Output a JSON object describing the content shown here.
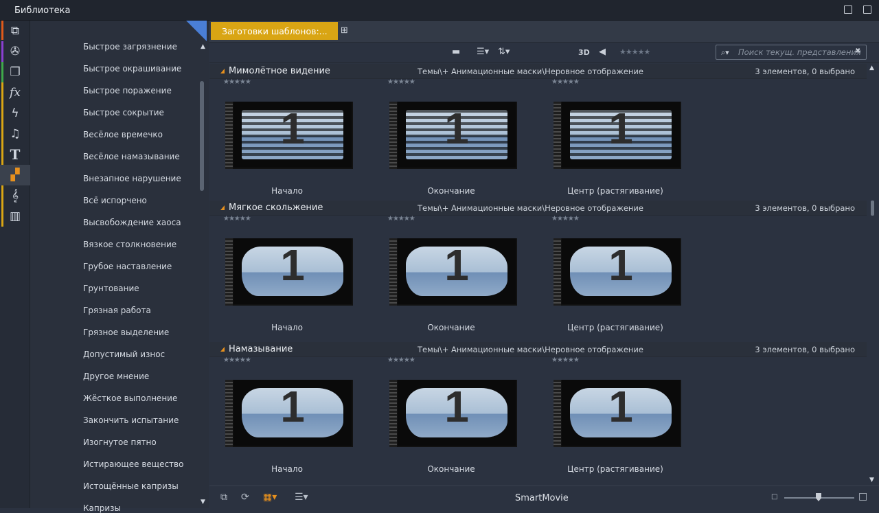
{
  "window": {
    "title": "Библиотека"
  },
  "categories": [
    "Быстрое загрязнение",
    "Быстрое окрашивание",
    "Быстрое поражение",
    "Быстрое сокрытие",
    "Весёлое времечко",
    "Весёлое намазывание",
    "Внезапное нарушение",
    "Всё испорчено",
    "Высвобождение хаоса",
    "Вязкое столкновение",
    "Грубое наставление",
    "Грунтование",
    "Грязная работа",
    "Грязное выделение",
    "Допустимый износ",
    "Другое мнение",
    "Жёсткое выполнение",
    "Закончить испытание",
    "Изогнутое пятно",
    "Истирающее вещество",
    "Истощённые капризы",
    "Капризы"
  ],
  "tab": {
    "label": "Заготовки шаблонов:..."
  },
  "toolbar": {
    "mode_3d": "3D",
    "rating": "★★★★★"
  },
  "search": {
    "placeholder": "Поиск текущ. представления"
  },
  "sections": [
    {
      "title": "Мимолётное видение",
      "path": "Темы\\+ Анимационные маски\\Неровное отображение",
      "count": "3 элементов, 0 выбрано",
      "items": [
        {
          "label": "Начало",
          "rating": "★★★★★",
          "num": "1"
        },
        {
          "label": "Окончание",
          "rating": "★★★★★",
          "num": "1"
        },
        {
          "label": "Центр (растягивание)",
          "rating": "★★★★★",
          "num": "1"
        }
      ]
    },
    {
      "title": "Мягкое скольжение",
      "path": "Темы\\+ Анимационные маски\\Неровное отображение",
      "count": "3 элементов, 0 выбрано",
      "items": [
        {
          "label": "Начало",
          "rating": "★★★★★",
          "num": "1"
        },
        {
          "label": "Окончание",
          "rating": "★★★★★",
          "num": "1"
        },
        {
          "label": "Центр (растягивание)",
          "rating": "★★★★★",
          "num": "1"
        }
      ]
    },
    {
      "title": "Намазывание",
      "path": "Темы\\+ Анимационные маски\\Неровное отображение",
      "count": "3 элементов, 0 выбрано",
      "items": [
        {
          "label": "Начало",
          "rating": "★★★★★",
          "num": "1"
        },
        {
          "label": "Окончание",
          "rating": "★★★★★",
          "num": "1"
        },
        {
          "label": "Центр (растягивание)",
          "rating": "★★★★★",
          "num": "1"
        }
      ]
    }
  ],
  "statusbar": {
    "app_name": "SmartMovie"
  },
  "icons": {
    "rail": [
      "stack-icon",
      "film-reel-icon",
      "layers-icon",
      "fx-icon",
      "lightning-icon",
      "music-note-icon",
      "text-t-icon",
      "montage-icon",
      "score-icon",
      "piano-icon"
    ]
  },
  "colors": {
    "accent": "#d9a514",
    "orange": "#e6901e"
  }
}
